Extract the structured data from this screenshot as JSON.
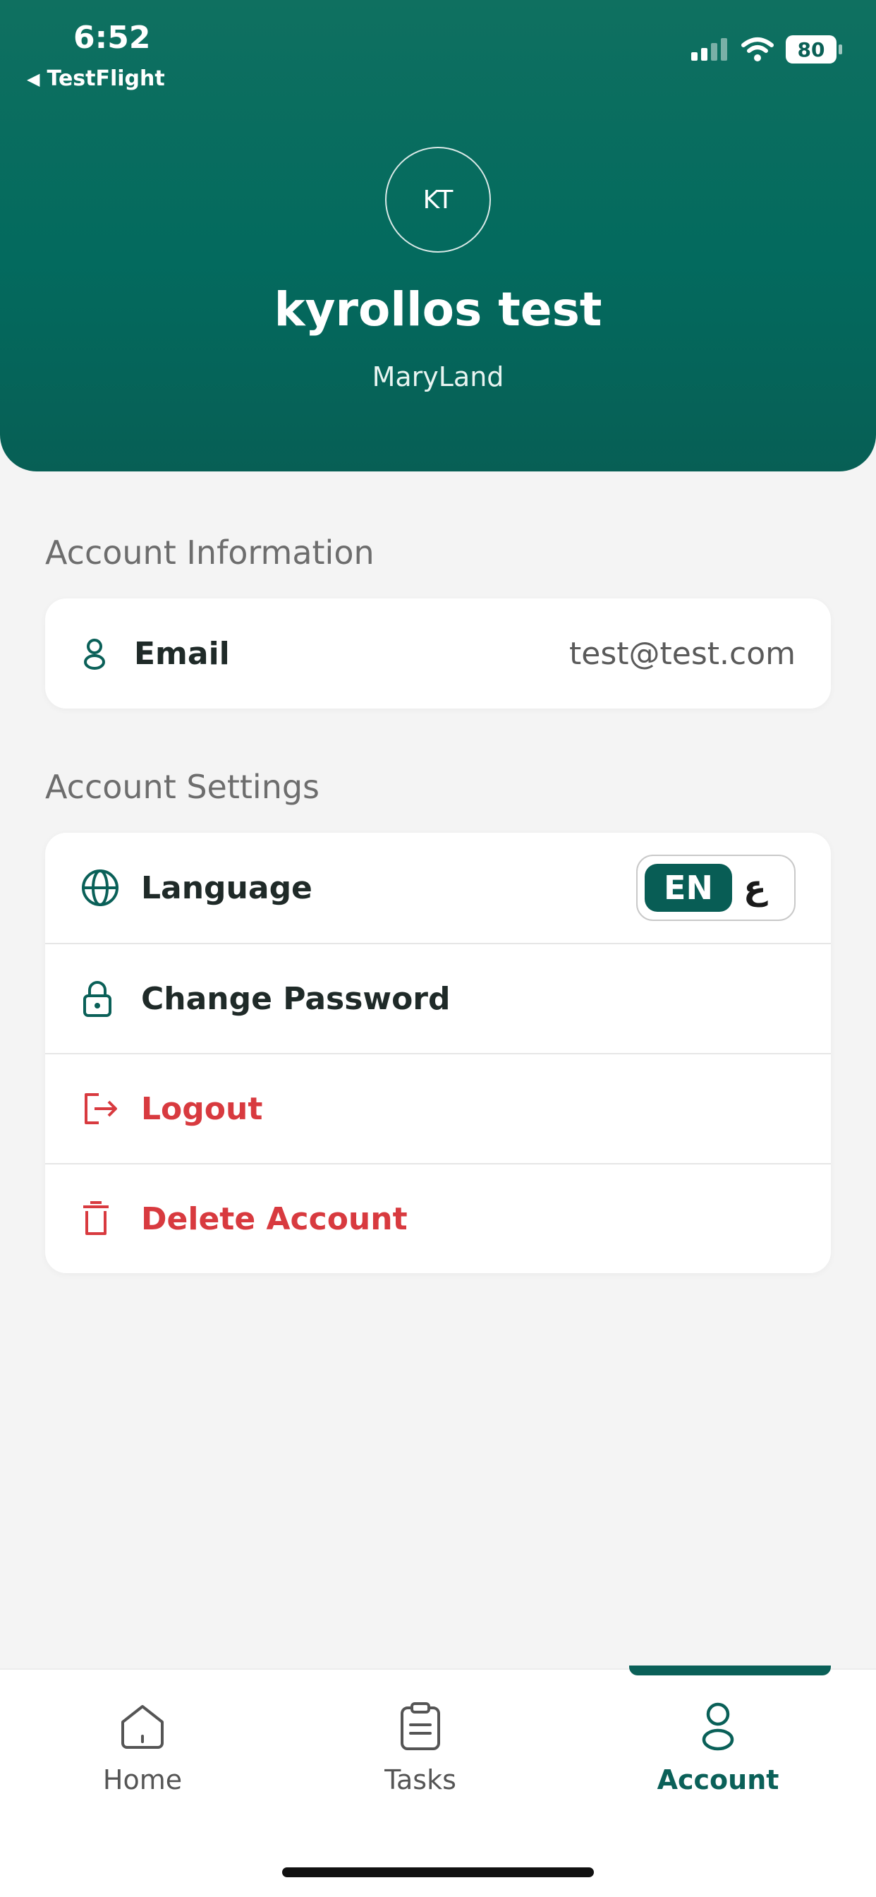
{
  "status_bar": {
    "time": "6:52",
    "back_label": "TestFlight",
    "battery": "80"
  },
  "profile": {
    "initials": "KT",
    "name": "kyrollos test",
    "location": "MaryLand"
  },
  "account_information": {
    "title": "Account Information",
    "email_label": "Email",
    "email_value": "test@test.com"
  },
  "account_settings": {
    "title": "Account Settings",
    "language_label": "Language",
    "language_selected": "EN",
    "language_alt": "ع",
    "change_password_label": "Change Password",
    "logout_label": "Logout",
    "delete_account_label": "Delete Account"
  },
  "bottom_nav": {
    "items": [
      {
        "label": "Home",
        "icon": "home-icon"
      },
      {
        "label": "Tasks",
        "icon": "clipboard-icon"
      },
      {
        "label": "Account",
        "icon": "person-icon"
      }
    ],
    "active": "Account"
  },
  "colors": {
    "brand": "#036a5e",
    "danger": "#d83a3f",
    "background": "#f4f4f4"
  }
}
